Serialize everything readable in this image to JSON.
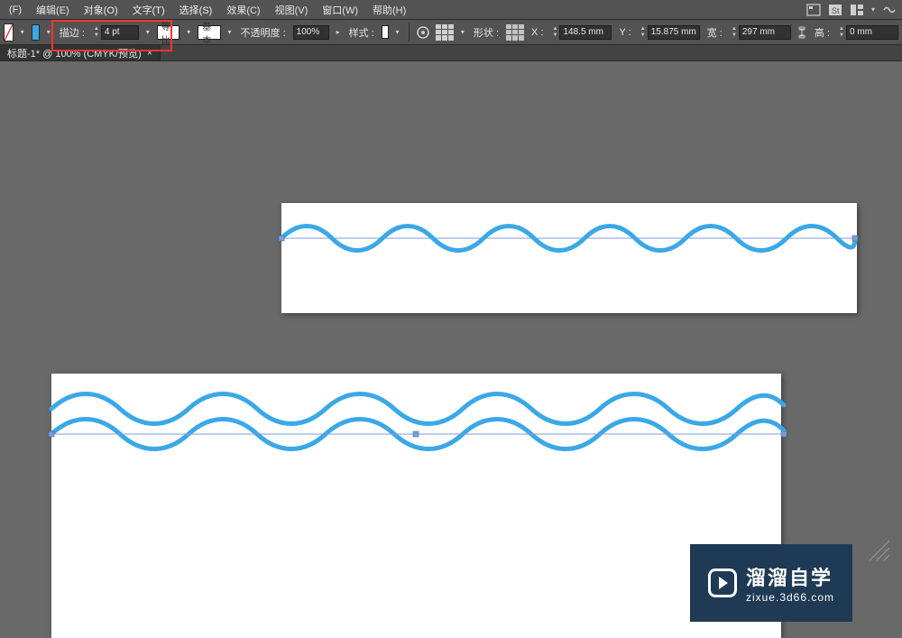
{
  "menu": {
    "file": "(F)",
    "edit": "编辑(E)",
    "object": "对象(O)",
    "type": "文字(T)",
    "select": "选择(S)",
    "effect": "效果(C)",
    "view": "视图(V)",
    "window": "窗口(W)",
    "help": "帮助(H)"
  },
  "control": {
    "stroke_label": "描边 :",
    "stroke_weight": "4 pt",
    "stroke_style_label": "等比",
    "stroke_profile_label": "基本",
    "opacity_label": "不透明度 :",
    "opacity_value": "100%",
    "style_label": "样式 :",
    "shape_label": "形状 :",
    "x_label": "X :",
    "x_value": "148.5 mm",
    "y_label": "Y :",
    "y_value": "15.875 mm",
    "w_label": "宽 :",
    "w_value": "297 mm",
    "h_label": "高 :",
    "h_value": "0 mm"
  },
  "tab": {
    "title": "标题-1* @ 100% (CMYK/预览)"
  },
  "watermark": {
    "cn": "溜溜自学",
    "url": "zixue.3d66.com"
  },
  "colors": {
    "wave_stroke": "#3aa8e8",
    "highlight": "#ff3333",
    "panel_bg": "#535353",
    "canvas_bg": "#696969"
  }
}
